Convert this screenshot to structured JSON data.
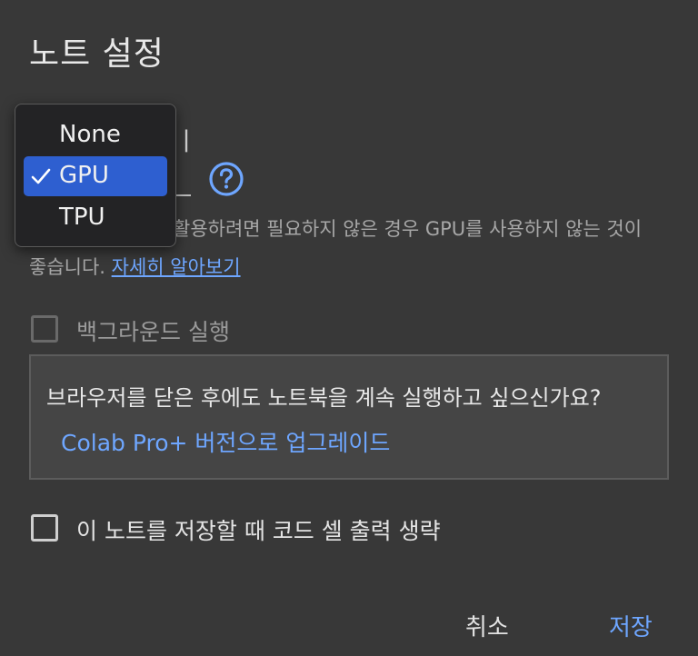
{
  "dialog": {
    "title": "노트 설정"
  },
  "accelerator": {
    "section_label_partial": "ㅣ",
    "select_value": "",
    "help_icon": "help-circle-icon",
    "hint_line1": "활용하려면 필요하지 않은 경우 GPU를 사용하지 않는 것이",
    "hint_line2_prefix": "좋습니다. ",
    "learn_more_link": "자세히 알아보기"
  },
  "dropdown": {
    "options": [
      {
        "label": "None",
        "selected": false
      },
      {
        "label": "GPU",
        "selected": true
      },
      {
        "label": "TPU",
        "selected": false
      }
    ],
    "check_icon": "checkmark-icon"
  },
  "background_execution": {
    "label": "백그라운드 실행",
    "checked": false,
    "disabled": true
  },
  "upsell": {
    "text": "브라우저를 닫은 후에도 노트북을 계속 실행하고 싶으신가요?",
    "link": "Colab Pro+ 버전으로 업그레이드"
  },
  "omit_output": {
    "label": "이 노트를 저장할 때 코드 셀 출력 생략",
    "checked": false
  },
  "footer": {
    "cancel_label": "취소",
    "save_label": "저장"
  },
  "colors": {
    "background": "#383838",
    "accent": "#6ea6ff",
    "selected_option": "#2e5fd0"
  }
}
